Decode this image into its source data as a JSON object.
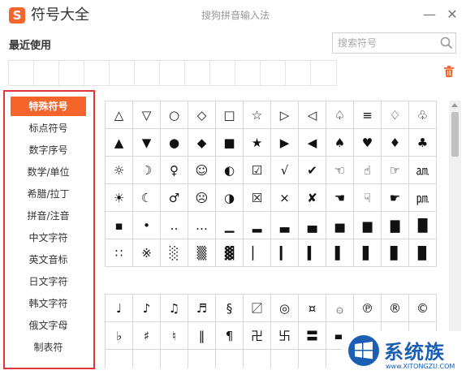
{
  "app": {
    "logo_char": "S",
    "title": "符号大全",
    "window_title": "搜狗拼音输入法",
    "minimize_glyph": "—",
    "close_glyph": "✕"
  },
  "recent": {
    "label": "最近使用",
    "cell_count": 13
  },
  "search": {
    "placeholder": "搜索符号"
  },
  "categories": [
    {
      "label": "特殊符号",
      "active": true
    },
    {
      "label": "标点符号",
      "active": false
    },
    {
      "label": "数字序号",
      "active": false
    },
    {
      "label": "数学/单位",
      "active": false
    },
    {
      "label": "希腊/拉丁",
      "active": false
    },
    {
      "label": "拼音/注音",
      "active": false
    },
    {
      "label": "中文字符",
      "active": false
    },
    {
      "label": "英文音标",
      "active": false
    },
    {
      "label": "日文字符",
      "active": false
    },
    {
      "label": "韩文字符",
      "active": false
    },
    {
      "label": "俄文字母",
      "active": false
    },
    {
      "label": "制表符",
      "active": false
    }
  ],
  "symbol_group_1": [
    [
      "△",
      "▽",
      "○",
      "◇",
      "□",
      "☆",
      "▷",
      "◁",
      "♤",
      "≡",
      "♢",
      "♧"
    ],
    [
      "▲",
      "▼",
      "●",
      "◆",
      "■",
      "★",
      "▶",
      "◀",
      "♠",
      "♥",
      "♦",
      "♣"
    ],
    [
      "☼",
      "☽",
      "♀",
      "☺",
      "◐",
      "☑",
      "√",
      "✔",
      "☜",
      "☝",
      "☞",
      "㏂"
    ],
    [
      "☀",
      "☾",
      "♂",
      "☹",
      "◑",
      "☒",
      "×",
      "✘",
      "☚",
      "☟",
      "☛",
      "㏘"
    ],
    [
      "▪",
      "•",
      "‥",
      "…",
      "▁",
      "▂",
      "▃",
      "▄",
      "▅",
      "▆",
      "▇",
      "█"
    ],
    [
      "∷",
      "※",
      "░",
      "▒",
      "▓",
      "▏",
      "▎",
      "▍",
      "▌",
      "▋",
      "▊",
      "▉"
    ]
  ],
  "symbol_group_2": [
    [
      "♩",
      "♪",
      "♫",
      "♬",
      "§",
      "〼",
      "◎",
      "¤",
      "۞",
      "℗",
      "®",
      "©"
    ],
    [
      "♭",
      "♯",
      "♮",
      "‖",
      "¶",
      "卍",
      "卐",
      "〓",
      "▬",
      "™",
      "℡",
      "№"
    ],
    [
      "",
      "",
      "",
      "",
      "",
      "",
      "",
      "",
      "",
      "",
      "",
      ""
    ]
  ],
  "watermark": {
    "text": "系统族",
    "url": "www.XITONGZU.COM"
  }
}
